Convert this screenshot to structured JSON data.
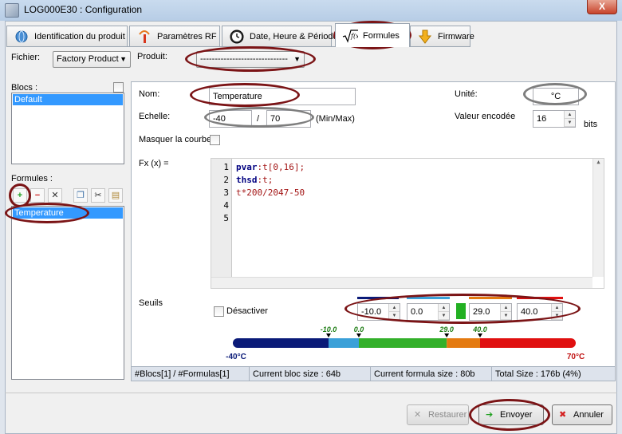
{
  "window": {
    "title": "LOG000E30 : Configuration",
    "close_label": "X"
  },
  "tabs": [
    {
      "label": "Identification du produit",
      "icon": "globe-icon"
    },
    {
      "label": "Paramètres RF",
      "icon": "antenna-icon"
    },
    {
      "label": "Date, Heure & Périodes",
      "icon": "clock-icon"
    },
    {
      "label": "Formules",
      "icon": "sqrt-fx-icon",
      "active": true
    },
    {
      "label": "Firmware",
      "icon": "download-arrow-icon"
    }
  ],
  "fichier": {
    "label": "Fichier:",
    "value": "Factory Product"
  },
  "produit": {
    "label": "Produit:",
    "value": "------------------------------"
  },
  "blocs": {
    "label": "Blocs :",
    "items": [
      "Default"
    ]
  },
  "formules": {
    "label": "Formules :",
    "items": [
      "Temperature"
    ]
  },
  "form": {
    "nom_label": "Nom:",
    "nom_value": "Temperature",
    "unite_label": "Unité:",
    "unite_value": "°C",
    "echelle_label": "Echelle:",
    "echelle_min": "-40",
    "echelle_sep": "/",
    "echelle_max": "70",
    "echelle_suffix": "(Min/Max)",
    "valeur_label": "Valeur encodée",
    "valeur_value": "16",
    "valeur_suffix": "bits",
    "masquer_label": "Masquer la courbe",
    "fx_label": "Fx (x) ="
  },
  "code_lines": [
    {
      "num": "1",
      "kw": "pvar",
      "rest": ":t[0,16];"
    },
    {
      "num": "2",
      "kw": "thsd",
      "rest": ":t;"
    },
    {
      "num": "3",
      "kw": "",
      "rest": "t*200/2047-50"
    },
    {
      "num": "4",
      "kw": "",
      "rest": ""
    },
    {
      "num": "5",
      "kw": "",
      "rest": ""
    }
  ],
  "seuils": {
    "label": "Seuils",
    "desactiver_label": "Désactiver",
    "values": [
      "-10.0",
      "0.0",
      "29.0",
      "40.0"
    ],
    "swatch_color": "#22b022"
  },
  "scale_bar": {
    "min": -40,
    "max": 70,
    "min_label": "-40°C",
    "max_label": "70°C",
    "marker_labels": [
      "-10.0",
      "0.0",
      "29.0",
      "40.0"
    ],
    "segments": [
      {
        "from": -40,
        "to": -10,
        "color": "#0a1a78"
      },
      {
        "from": -10,
        "to": 0,
        "color": "#3aa0d8"
      },
      {
        "from": 0,
        "to": 29,
        "color": "#33b02a"
      },
      {
        "from": 29,
        "to": 40,
        "color": "#e47a10"
      },
      {
        "from": 40,
        "to": 70,
        "color": "#e01010"
      }
    ]
  },
  "status": {
    "blocs_formulas": "#Blocs[1] / #Formulas[1]",
    "bloc_size": "Current bloc size : 64b",
    "formula_size": "Current formula size : 80b",
    "total_size": "Total Size : 176b (4%)"
  },
  "buttons": {
    "restaurer": "Restaurer",
    "envoyer": "Envoyer",
    "annuler": "Annuler"
  }
}
